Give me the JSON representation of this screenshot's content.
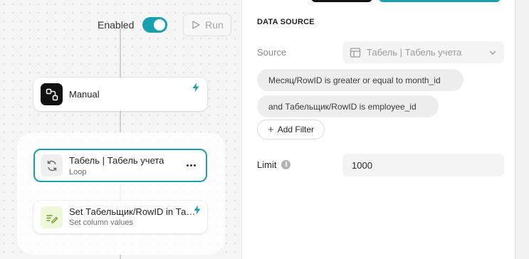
{
  "canvas": {
    "enabled_label": "Enabled",
    "enabled": true,
    "run_label": "Run",
    "nodes": {
      "manual": {
        "title": "Manual"
      },
      "loop": {
        "title": "Табель | Табель учета",
        "subtitle": "Loop"
      },
      "set": {
        "title": "Set Табельщик/RowID in Табель",
        "subtitle": "Set column values"
      }
    }
  },
  "panel": {
    "section_title": "DATA SOURCE",
    "source_label": "Source",
    "source_value": "Табель | Табель учета",
    "filters": [
      "Месяц/RowID is greater or equal to month_id",
      "and Табельщик/RowID  is employee_id"
    ],
    "add_filter_label": "Add Filter",
    "limit_label": "Limit",
    "limit_value": "1000"
  },
  "colors": {
    "accent": "#1a9fae",
    "chip_bg": "#ededed",
    "field_bg": "#f4f4f4"
  },
  "icons": {
    "toggle": "toggle-switch",
    "run": "play-icon",
    "manual": "manual-trigger-icon",
    "loop": "loop-icon",
    "set": "edit-columns-icon",
    "bolt": "bolt-icon",
    "more": "more-horizontal-icon",
    "source": "table-icon",
    "chevron": "chevron-down-icon",
    "info": "info-icon",
    "plus": "plus-icon"
  }
}
